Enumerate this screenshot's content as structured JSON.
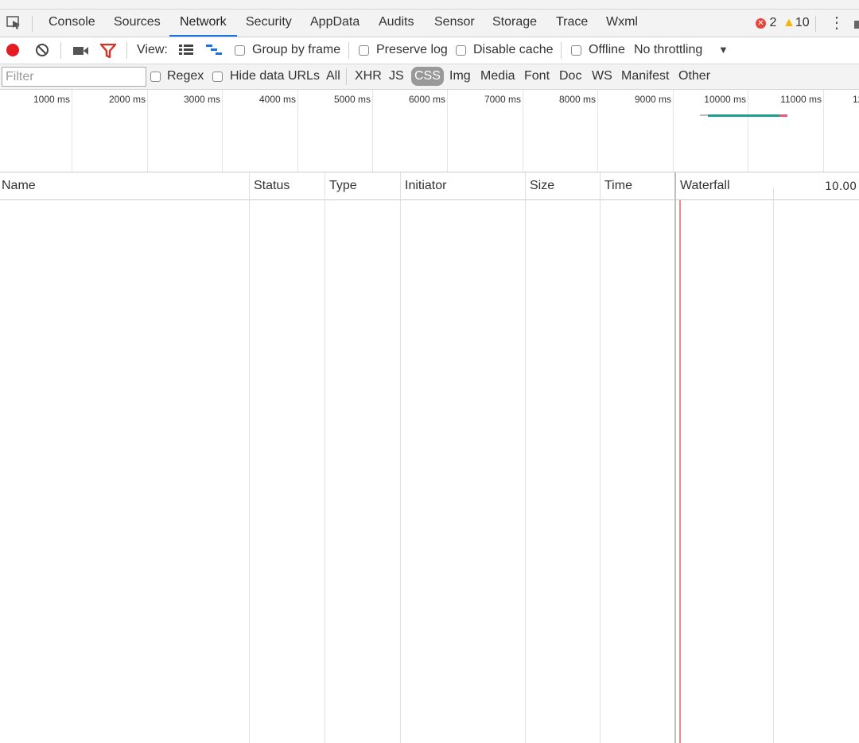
{
  "tabs": [
    "Console",
    "Sources",
    "Network",
    "Security",
    "AppData",
    "Audits",
    "Sensor",
    "Storage",
    "Trace",
    "Wxml"
  ],
  "active_tab": "Network",
  "errors": {
    "count": "2",
    "color": "#e8453c"
  },
  "warnings": {
    "count": "10",
    "color": "#f2b600"
  },
  "toolbar": {
    "view_label": "View:",
    "group_by_frame": "Group by frame",
    "preserve_log": "Preserve log",
    "disable_cache": "Disable cache",
    "offline": "Offline",
    "throttling": "No throttling"
  },
  "filterbar": {
    "placeholder": "Filter",
    "regex": "Regex",
    "hide_data_urls": "Hide data URLs",
    "types": [
      "All",
      "XHR",
      "JS",
      "CSS",
      "Img",
      "Media",
      "Font",
      "Doc",
      "WS",
      "Manifest",
      "Other"
    ],
    "selected_type": "CSS"
  },
  "overview": {
    "ticks": [
      "1000 ms",
      "2000 ms",
      "3000 ms",
      "4000 ms",
      "5000 ms",
      "6000 ms",
      "7000 ms",
      "8000 ms",
      "9000 ms",
      "10000 ms",
      "11000 ms",
      "12"
    ]
  },
  "columns": [
    "Name",
    "Status",
    "Type",
    "Initiator",
    "Size",
    "Time",
    "Waterfall"
  ],
  "waterfall_scale": "10.00",
  "colors": {
    "accent": "#1a73e8",
    "record": "#e51c23",
    "filter_icon": "#d93025",
    "teal": "#1f9e8f",
    "load_line": "#e88a8a"
  }
}
